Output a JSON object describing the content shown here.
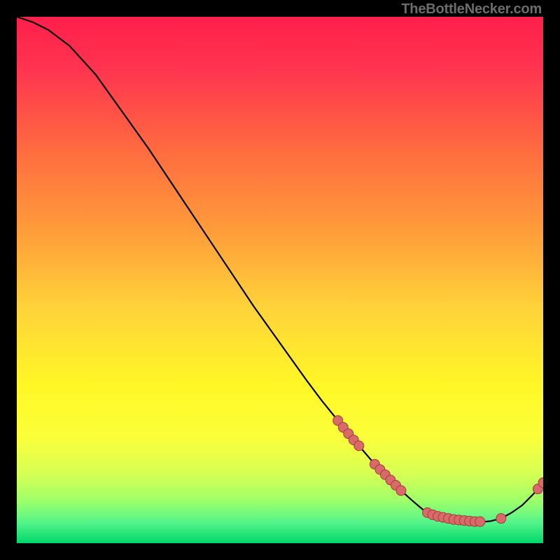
{
  "attribution": "TheBottleNecker.com",
  "chart_data": {
    "type": "line",
    "title": "",
    "xlabel": "",
    "ylabel": "",
    "xlim": [
      0,
      100
    ],
    "ylim": [
      0,
      100
    ],
    "curve": [
      {
        "x": 0,
        "y": 100
      },
      {
        "x": 3,
        "y": 99
      },
      {
        "x": 6,
        "y": 97.5
      },
      {
        "x": 10,
        "y": 94.5
      },
      {
        "x": 15,
        "y": 89
      },
      {
        "x": 20,
        "y": 82
      },
      {
        "x": 25,
        "y": 75
      },
      {
        "x": 30,
        "y": 67.5
      },
      {
        "x": 35,
        "y": 60
      },
      {
        "x": 40,
        "y": 52.5
      },
      {
        "x": 45,
        "y": 45
      },
      {
        "x": 50,
        "y": 38
      },
      {
        "x": 55,
        "y": 31
      },
      {
        "x": 58,
        "y": 27
      },
      {
        "x": 61,
        "y": 23.3
      },
      {
        "x": 62,
        "y": 22
      },
      {
        "x": 63,
        "y": 20.8
      },
      {
        "x": 64,
        "y": 19.6
      },
      {
        "x": 65,
        "y": 18.5
      },
      {
        "x": 68,
        "y": 15.0
      },
      {
        "x": 69,
        "y": 14.0
      },
      {
        "x": 70,
        "y": 13.0
      },
      {
        "x": 71,
        "y": 12.0
      },
      {
        "x": 72,
        "y": 11.0
      },
      {
        "x": 73,
        "y": 10.0
      },
      {
        "x": 75,
        "y": 8.2
      },
      {
        "x": 77,
        "y": 6.5
      },
      {
        "x": 78,
        "y": 5.8
      },
      {
        "x": 79,
        "y": 5.4
      },
      {
        "x": 80,
        "y": 5.1
      },
      {
        "x": 81,
        "y": 4.9
      },
      {
        "x": 82,
        "y": 4.7
      },
      {
        "x": 83,
        "y": 4.5
      },
      {
        "x": 84,
        "y": 4.4
      },
      {
        "x": 85,
        "y": 4.3
      },
      {
        "x": 86,
        "y": 4.2
      },
      {
        "x": 87,
        "y": 4.1
      },
      {
        "x": 88,
        "y": 4.1
      },
      {
        "x": 89,
        "y": 4.1
      },
      {
        "x": 90,
        "y": 4.2
      },
      {
        "x": 92,
        "y": 4.7
      },
      {
        "x": 94,
        "y": 5.8
      },
      {
        "x": 96,
        "y": 7.2
      },
      {
        "x": 98,
        "y": 9.2
      },
      {
        "x": 99,
        "y": 10.3
      },
      {
        "x": 100,
        "y": 11.5
      }
    ],
    "points": [
      {
        "x": 61,
        "y": 23.3
      },
      {
        "x": 62,
        "y": 22
      },
      {
        "x": 63,
        "y": 20.8
      },
      {
        "x": 64,
        "y": 19.6
      },
      {
        "x": 65,
        "y": 18.5
      },
      {
        "x": 68,
        "y": 15.0
      },
      {
        "x": 69,
        "y": 14.0
      },
      {
        "x": 70,
        "y": 13.0
      },
      {
        "x": 71,
        "y": 12.0
      },
      {
        "x": 72,
        "y": 11.0
      },
      {
        "x": 73,
        "y": 10.0
      },
      {
        "x": 78,
        "y": 5.8
      },
      {
        "x": 79,
        "y": 5.4
      },
      {
        "x": 80,
        "y": 5.1
      },
      {
        "x": 81,
        "y": 4.9
      },
      {
        "x": 82,
        "y": 4.7
      },
      {
        "x": 83,
        "y": 4.5
      },
      {
        "x": 84,
        "y": 4.4
      },
      {
        "x": 85,
        "y": 4.3
      },
      {
        "x": 86,
        "y": 4.2
      },
      {
        "x": 87,
        "y": 4.1
      },
      {
        "x": 88,
        "y": 4.1
      },
      {
        "x": 92,
        "y": 4.7
      },
      {
        "x": 99,
        "y": 10.3
      },
      {
        "x": 100,
        "y": 11.5
      }
    ],
    "colors": {
      "gradient_top": "#ff1f4b",
      "gradient_mid_orange": "#ff8a3a",
      "gradient_yellow": "#fff700",
      "gradient_lightgreen": "#b6ff7a",
      "gradient_green": "#00e05a",
      "line": "#000000",
      "point_fill": "#d86a6a",
      "point_edge": "#a83a3a"
    }
  }
}
